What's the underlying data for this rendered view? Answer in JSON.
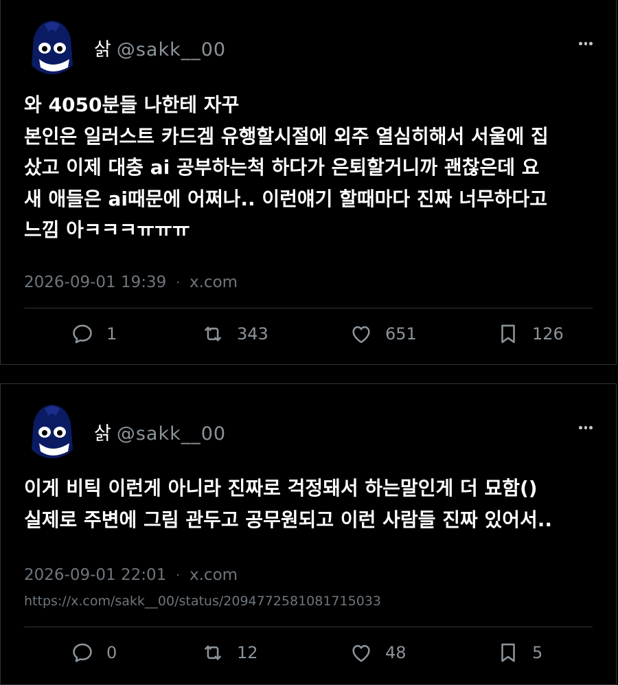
{
  "posts": [
    {
      "display_name": "삵",
      "handle": "@sakk__00",
      "lines": [
        "와 4050분들 나한테 자꾸",
        "본인은 일러스트 카드겜 유행할시절에 외주 열심히해서 서울에 집",
        "샀고 이제 대충 ai 공부하는척 하다가 은퇴할거니까 괜찮은데 요",
        "새 애들은 ai때문에 어쩌나.. 이런얘기 할때마다 진짜 너무하다고",
        "느낌 아ㅋㅋㅋㅠㅠㅠ"
      ],
      "timestamp": "2026-09-01 19:39",
      "separator": "·",
      "source": "x.com",
      "url": "",
      "replies": "1",
      "reposts": "343",
      "likes": "651",
      "bookmarks": "126"
    },
    {
      "display_name": "삵",
      "handle": "@sakk__00",
      "lines": [
        "이게 비틱 이런게 아니라 진짜로 걱정돼서 하는말인게 더 묘함()",
        "실제로 주변에 그림 관두고 공무원되고 이런 사람들 진짜 있어서.."
      ],
      "timestamp": "2026-09-01 22:01",
      "separator": "·",
      "source": "x.com",
      "url": "https://x.com/sakk__00/status/2094772581081715033",
      "replies": "0",
      "reposts": "12",
      "likes": "48",
      "bookmarks": "5"
    }
  ],
  "icons": {
    "reply": "reply-icon",
    "repost": "repost-icon",
    "like": "heart-icon",
    "bookmark": "bookmark-icon",
    "more": "more-icon"
  },
  "colors": {
    "background": "#000000",
    "text": "#ffffff",
    "muted": "#6e767d",
    "avatar_body": "#0b1b63"
  }
}
